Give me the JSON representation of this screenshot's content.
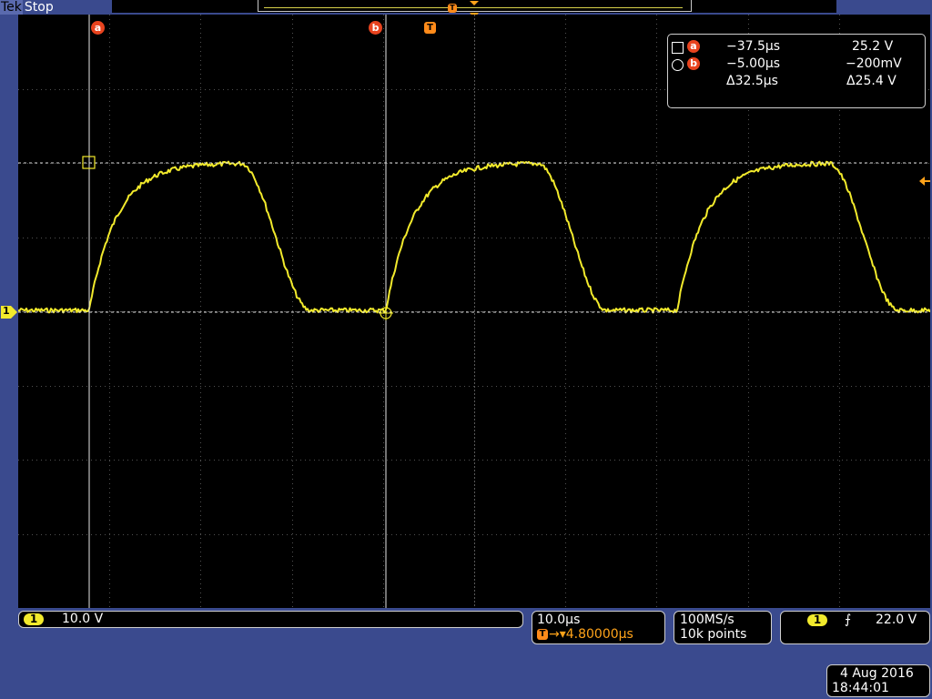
{
  "header": {
    "brand": "Tek",
    "acq_state": "Stop",
    "record_trigger_marker": "T"
  },
  "cursors": {
    "a_label": "a",
    "b_label": "b",
    "trigger_label": "T"
  },
  "readout": {
    "a": {
      "label": "a",
      "time": "−37.5µs",
      "volts": "25.2 V"
    },
    "b": {
      "label": "b",
      "time": "−5.00µs",
      "volts": "−200mV"
    },
    "delta": {
      "time": "Δ32.5µs",
      "volts": "Δ25.4 V"
    }
  },
  "channel": {
    "number": "1",
    "scale": "10.0 V",
    "color": "#f2ea2c"
  },
  "timebase": {
    "scale": "10.0µs",
    "trigger_symbol": "T",
    "delay": "→▾4.80000µs"
  },
  "acquisition": {
    "sample_rate": "100MS/s",
    "record_length": "10k points"
  },
  "trigger": {
    "channel": "1",
    "slope_symbol": "⨍",
    "level": "22.0 V"
  },
  "datetime": {
    "date": "4 Aug 2016",
    "time": "18:44:01"
  },
  "colors": {
    "background": "#3a4a8e",
    "screen": "#000000",
    "trace": "#f2ea2c",
    "cursor_badge": "#e8431e",
    "trigger_marker": "#ffa31a"
  }
}
